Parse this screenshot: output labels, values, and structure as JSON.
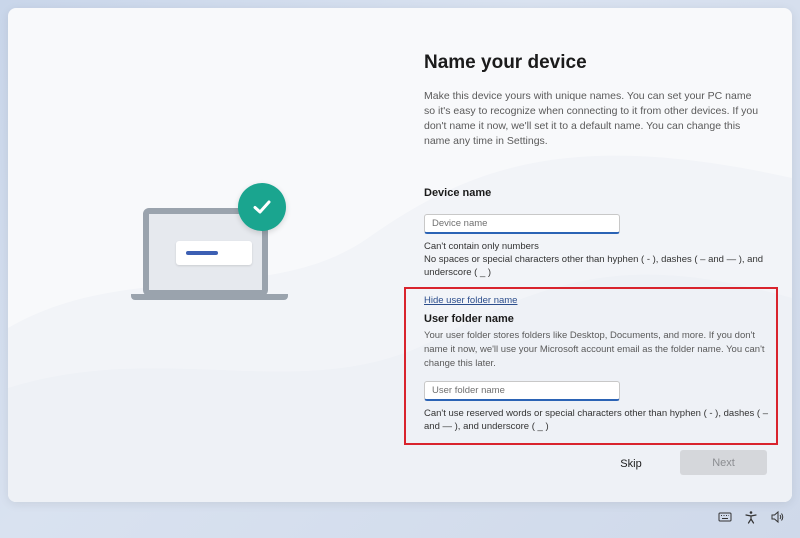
{
  "page": {
    "title": "Name your device",
    "intro": "Make this device yours with unique names. You can set your PC name so it's easy to recognize when connecting to it from other devices. If you don't name it now, we'll set it to a default name. You can change this name any time in Settings."
  },
  "device_name": {
    "label": "Device name",
    "placeholder": "Device name",
    "value": "",
    "hint_line1": "Can't contain only numbers",
    "hint_line2": "No spaces or special characters other than hyphen ( - ), dashes ( – and — ), and underscore ( _ )"
  },
  "user_folder": {
    "toggle_link": "Hide user folder name",
    "label": "User folder name",
    "description": "Your user folder stores folders like Desktop, Documents, and more. If you don't name it now, we'll use your Microsoft account email as the folder name. You can't change this later.",
    "placeholder": "User folder name",
    "value": "",
    "hint": "Can't use reserved words or special characters other than hyphen ( - ), dashes ( – and — ), and underscore ( _ )"
  },
  "actions": {
    "skip_label": "Skip",
    "next_label": "Next"
  },
  "tray": {
    "icons": [
      "keyboard-icon",
      "accessibility-icon",
      "volume-icon"
    ]
  },
  "colors": {
    "accent": "#2b63b5",
    "check_badge": "#1aa58f",
    "highlight": "#d9232d",
    "disabled_button": "#d5d7db"
  }
}
